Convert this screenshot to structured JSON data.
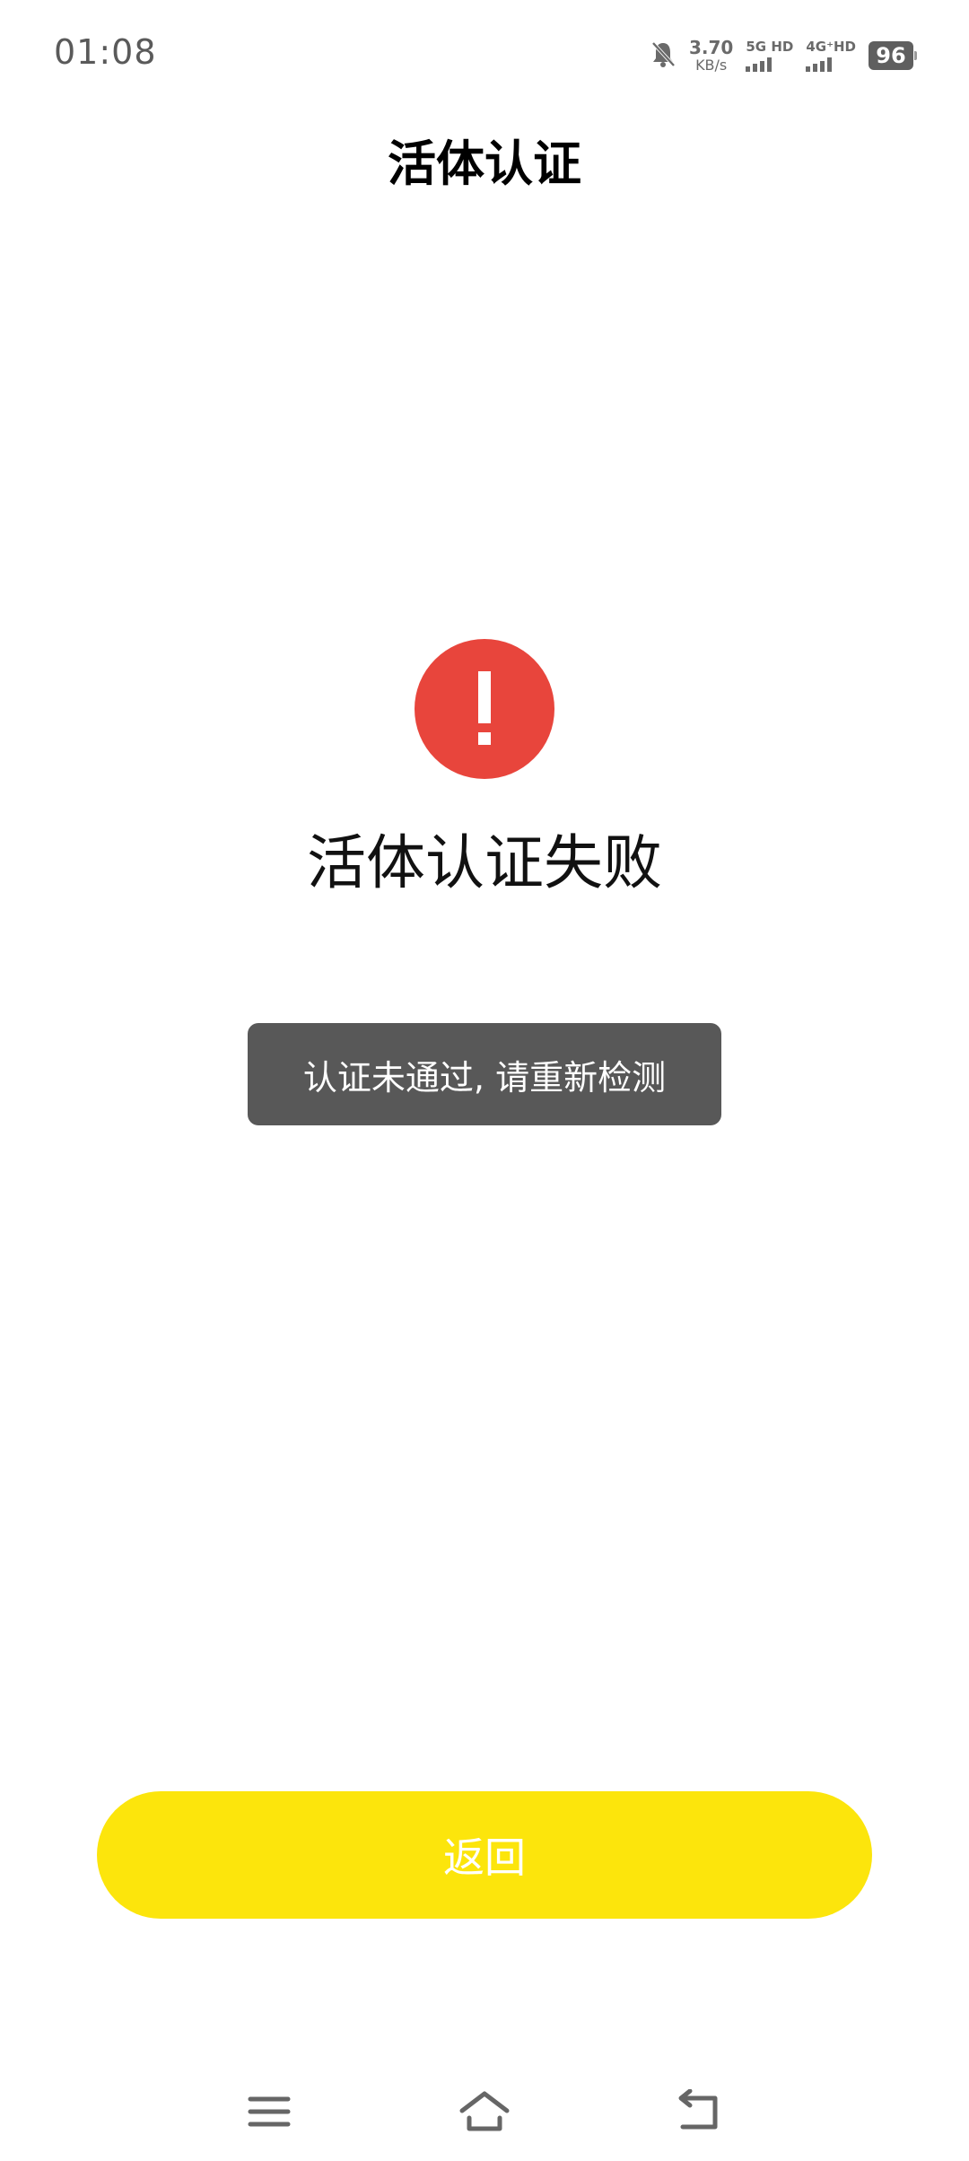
{
  "status_bar": {
    "time": "01:08",
    "net_speed_value": "3.70",
    "net_speed_unit": "KB/s",
    "sim1_label": "5G HD",
    "sim2_label": "4G⁺HD",
    "battery": "96",
    "icons": [
      "mute-bell-icon",
      "signal-5g-icon",
      "signal-4g-icon",
      "battery-icon"
    ]
  },
  "header": {
    "title": "活体认证"
  },
  "result": {
    "icon": "exclamation-icon",
    "icon_color": "#e8453c",
    "title": "活体认证失败"
  },
  "toast": {
    "message": "认证未通过, 请重新检测"
  },
  "actions": {
    "return_label": "返回",
    "return_color": "#fce50c"
  },
  "nav": {
    "items": [
      "menu-icon",
      "home-icon",
      "back-icon"
    ]
  }
}
